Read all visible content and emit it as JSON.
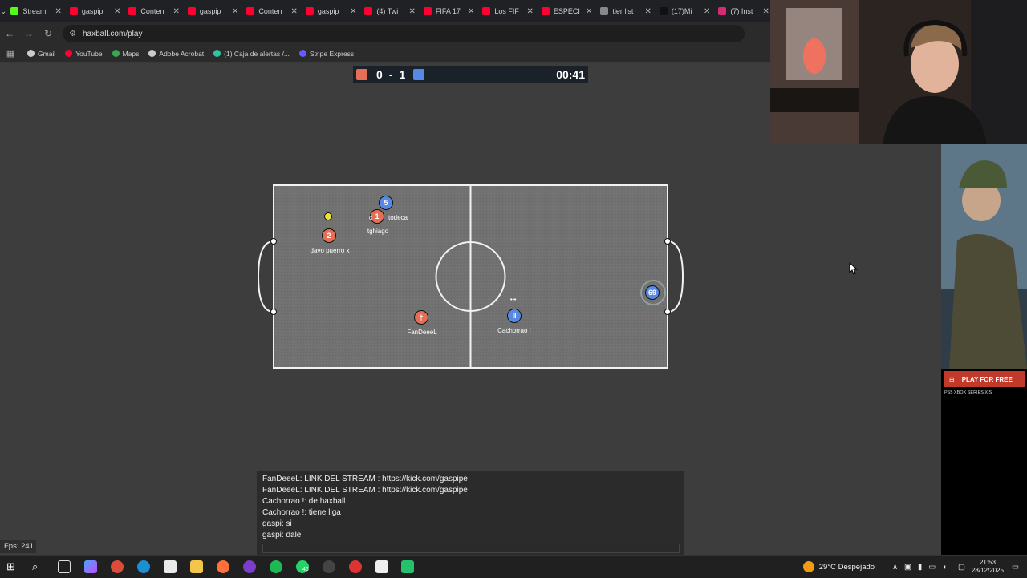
{
  "browser": {
    "tabs": [
      {
        "label": "Stream",
        "color": "#53fc18"
      },
      {
        "label": "gaspip",
        "color": "#ff0033"
      },
      {
        "label": "Conten",
        "color": "#ff0033"
      },
      {
        "label": "gaspip",
        "color": "#ff0033"
      },
      {
        "label": "Conten",
        "color": "#ff0033"
      },
      {
        "label": "gaspip",
        "color": "#ff0033"
      },
      {
        "label": "(4) Twi",
        "color": "#ff0033"
      },
      {
        "label": "FIFA 17",
        "color": "#ff0033"
      },
      {
        "label": "Los FIF",
        "color": "#ff0033"
      },
      {
        "label": "ESPECI",
        "color": "#ff0033"
      },
      {
        "label": "tier list",
        "color": "#888888"
      },
      {
        "label": "(17)Mi",
        "color": "#111111"
      },
      {
        "label": "(7) Inst",
        "color": "#d62976"
      }
    ],
    "url": "haxball.com/play",
    "bookmarks": [
      {
        "label": "Gmail",
        "color": "#cccccc"
      },
      {
        "label": "YouTube",
        "color": "#ff0033"
      },
      {
        "label": "Maps",
        "color": "#34a853"
      },
      {
        "label": "Adobe Acrobat",
        "color": "#cccccc"
      },
      {
        "label": "(1) Caja de alertas /...",
        "color": "#2ec4a0"
      },
      {
        "label": "Stripe Express",
        "color": "#635bff"
      }
    ]
  },
  "game": {
    "score": {
      "red": "0",
      "sep": "-",
      "blue": "1",
      "time": "00:41",
      "red_color": "#e56e56",
      "blue_color": "#5689e5"
    },
    "players": [
      {
        "number": "5",
        "team": "blue",
        "name": ""
      },
      {
        "number": "1",
        "team": "red",
        "name": "tghiago"
      },
      {
        "number": "2",
        "team": "red",
        "name": "davo puerro x"
      },
      {
        "number": "†",
        "team": "red",
        "name": "FanDeeeL"
      },
      {
        "number": "II",
        "team": "blue",
        "name": "Cachorrao !"
      },
      {
        "number": "69",
        "team": "blue",
        "name": ""
      }
    ],
    "partial_label": "todeca",
    "partial_prefix": "c",
    "chat_icon": "•••"
  },
  "chat": {
    "lines": [
      "FanDeeeL: LINK DEL STREAM : https://kick.com/gaspipe",
      "FanDeeeL: LINK DEL STREAM : https://kick.com/gaspipe",
      "Cachorrao !: de haxball",
      "Cachorrao !: tiene liga",
      "gaspi: si",
      "gaspi: dale"
    ]
  },
  "fps": "Fps: 241",
  "ad": {
    "cta": "PLAY FOR FREE",
    "platforms": "PS5   XBOX SERIES X|S"
  },
  "taskbar": {
    "weather": "29°C  Despejado",
    "time": "21:53",
    "date": "28/12/2025",
    "badge": "46"
  }
}
